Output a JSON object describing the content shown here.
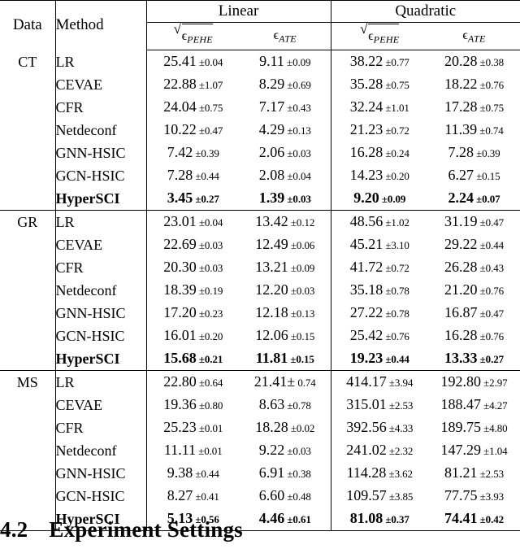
{
  "table": {
    "headers": {
      "data": "Data",
      "method": "Method",
      "groups": [
        "Linear",
        "Quadratic"
      ],
      "metrics": {
        "pehe_symbol": "ϵ",
        "pehe_sub": "PEHE",
        "ate_symbol": "ϵ",
        "ate_sub": "ATE",
        "pehe_label": "√ϵ_PEHE",
        "ate_label": "ϵ_ATE"
      }
    },
    "sections": [
      {
        "data_label": "CT",
        "rows": [
          {
            "method": "LR",
            "bold": false,
            "linear_pehe": "25.41",
            "linear_pehe_err": "±0.04",
            "linear_ate": "9.11",
            "linear_ate_err": "±0.09",
            "quad_pehe": "38.22",
            "quad_pehe_err": "±0.77",
            "quad_ate": "20.28",
            "quad_ate_err": "±0.38"
          },
          {
            "method": "CEVAE",
            "bold": false,
            "linear_pehe": "22.88",
            "linear_pehe_err": "±1.07",
            "linear_ate": "8.29",
            "linear_ate_err": "±0.69",
            "quad_pehe": "35.28",
            "quad_pehe_err": "±0.75",
            "quad_ate": "18.22",
            "quad_ate_err": "±0.76"
          },
          {
            "method": "CFR",
            "bold": false,
            "linear_pehe": "24.04",
            "linear_pehe_err": "±0.75",
            "linear_ate": "7.17",
            "linear_ate_err": "±0.43",
            "quad_pehe": "32.24",
            "quad_pehe_err": "±1.01",
            "quad_ate": "17.28",
            "quad_ate_err": "±0.75"
          },
          {
            "method": "Netdeconf",
            "bold": false,
            "linear_pehe": "10.22",
            "linear_pehe_err": "±0.47",
            "linear_ate": "4.29",
            "linear_ate_err": "±0.13",
            "quad_pehe": "21.23",
            "quad_pehe_err": "±0.72",
            "quad_ate": "11.39",
            "quad_ate_err": "±0.74"
          },
          {
            "method": "GNN-HSIC",
            "bold": false,
            "linear_pehe": "7.42",
            "linear_pehe_err": "±0.39",
            "linear_ate": "2.06",
            "linear_ate_err": "±0.03",
            "quad_pehe": "16.28",
            "quad_pehe_err": "±0.24",
            "quad_ate": "7.28",
            "quad_ate_err": "±0.39"
          },
          {
            "method": "GCN-HSIC",
            "bold": false,
            "linear_pehe": "7.28",
            "linear_pehe_err": "±0.44",
            "linear_ate": "2.08",
            "linear_ate_err": "±0.04",
            "quad_pehe": "14.23",
            "quad_pehe_err": "±0.20",
            "quad_ate": "6.27",
            "quad_ate_err": "±0.15"
          },
          {
            "method": "HyperSCI",
            "bold": true,
            "linear_pehe": "3.45",
            "linear_pehe_err": "±0.27",
            "linear_ate": "1.39",
            "linear_ate_err": "±0.03",
            "quad_pehe": "9.20",
            "quad_pehe_err": "±0.09",
            "quad_ate": "2.24",
            "quad_ate_err": "±0.07"
          }
        ]
      },
      {
        "data_label": "GR",
        "rows": [
          {
            "method": "LR",
            "bold": false,
            "linear_pehe": "23.01",
            "linear_pehe_err": "±0.04",
            "linear_ate": "13.42",
            "linear_ate_err": "±0.12",
            "quad_pehe": "48.56",
            "quad_pehe_err": "±1.02",
            "quad_ate": "31.19",
            "quad_ate_err": "±0.47"
          },
          {
            "method": "CEVAE",
            "bold": false,
            "linear_pehe": "22.69",
            "linear_pehe_err": "±0.03",
            "linear_ate": "12.49",
            "linear_ate_err": "±0.06",
            "quad_pehe": "45.21",
            "quad_pehe_err": "±3.10",
            "quad_ate": "29.22",
            "quad_ate_err": "±0.44"
          },
          {
            "method": "CFR",
            "bold": false,
            "linear_pehe": "20.30",
            "linear_pehe_err": "±0.03",
            "linear_ate": "13.21",
            "linear_ate_err": "±0.09",
            "quad_pehe": "41.72",
            "quad_pehe_err": "±0.72",
            "quad_ate": "26.28",
            "quad_ate_err": "±0.43"
          },
          {
            "method": "Netdeconf",
            "bold": false,
            "linear_pehe": "18.39",
            "linear_pehe_err": "±0.19",
            "linear_ate": "12.20",
            "linear_ate_err": "±0.03",
            "quad_pehe": "35.18",
            "quad_pehe_err": "±0.78",
            "quad_ate": "21.20",
            "quad_ate_err": "±0.76"
          },
          {
            "method": "GNN-HSIC",
            "bold": false,
            "linear_pehe": "17.20",
            "linear_pehe_err": "±0.23",
            "linear_ate": "12.18",
            "linear_ate_err": "±0.13",
            "quad_pehe": "27.22",
            "quad_pehe_err": "±0.78",
            "quad_ate": "16.87",
            "quad_ate_err": "±0.47"
          },
          {
            "method": "GCN-HSIC",
            "bold": false,
            "linear_pehe": "16.01",
            "linear_pehe_err": "±0.20",
            "linear_ate": "12.06",
            "linear_ate_err": "±0.15",
            "quad_pehe": "25.42",
            "quad_pehe_err": "±0.76",
            "quad_ate": "16.28",
            "quad_ate_err": "±0.76"
          },
          {
            "method": "HyperSCI",
            "bold": true,
            "linear_pehe": "15.68",
            "linear_pehe_err": "±0.21",
            "linear_ate": "11.81",
            "linear_ate_err": "±0.15",
            "quad_pehe": "19.23",
            "quad_pehe_err": "±0.44",
            "quad_ate": "13.33",
            "quad_ate_err": "±0.27"
          }
        ]
      },
      {
        "data_label": "MS",
        "rows": [
          {
            "method": "LR",
            "bold": false,
            "linear_pehe": "22.80",
            "linear_pehe_err": "±0.64",
            "linear_ate": "21.41±",
            "linear_ate_err": "0.74",
            "quad_pehe": "414.17",
            "quad_pehe_err": "±3.94",
            "quad_ate": "192.80",
            "quad_ate_err": "±2.97"
          },
          {
            "method": "CEVAE",
            "bold": false,
            "linear_pehe": "19.36",
            "linear_pehe_err": "±0.80",
            "linear_ate": "8.63",
            "linear_ate_err": "±0.78",
            "quad_pehe": "315.01",
            "quad_pehe_err": "±2.53",
            "quad_ate": "188.47",
            "quad_ate_err": "±4.27"
          },
          {
            "method": "CFR",
            "bold": false,
            "linear_pehe": "25.23",
            "linear_pehe_err": "±0.01",
            "linear_ate": "18.28",
            "linear_ate_err": "±0.02",
            "quad_pehe": "392.56",
            "quad_pehe_err": "±4.33",
            "quad_ate": "189.75",
            "quad_ate_err": "±4.80"
          },
          {
            "method": "Netdeconf",
            "bold": false,
            "linear_pehe": "11.11",
            "linear_pehe_err": "±0.01",
            "linear_ate": "9.22",
            "linear_ate_err": "±0.03",
            "quad_pehe": "241.02",
            "quad_pehe_err": "±2.32",
            "quad_ate": "147.29",
            "quad_ate_err": "±1.04"
          },
          {
            "method": "GNN-HSIC",
            "bold": false,
            "linear_pehe": "9.38",
            "linear_pehe_err": "±0.44",
            "linear_ate": "6.91",
            "linear_ate_err": "±0.38",
            "quad_pehe": "114.28",
            "quad_pehe_err": "±3.62",
            "quad_ate": "81.21",
            "quad_ate_err": "±2.53"
          },
          {
            "method": "GCN-HSIC",
            "bold": false,
            "linear_pehe": "8.27",
            "linear_pehe_err": "±0.41",
            "linear_ate": "6.60",
            "linear_ate_err": "±0.48",
            "quad_pehe": "109.57",
            "quad_pehe_err": "±3.85",
            "quad_ate": "77.75",
            "quad_ate_err": "±3.93"
          },
          {
            "method": "HyperSCI",
            "bold": true,
            "linear_pehe": "5.13",
            "linear_pehe_err": "±0.56",
            "linear_ate": "4.46",
            "linear_ate_err": "±0.61",
            "quad_pehe": "81.08",
            "quad_pehe_err": "±0.37",
            "quad_ate": "74.41",
            "quad_ate_err": "±0.42"
          }
        ]
      }
    ]
  },
  "section_heading": {
    "number": "4.2",
    "title": "Experiment Settings"
  }
}
